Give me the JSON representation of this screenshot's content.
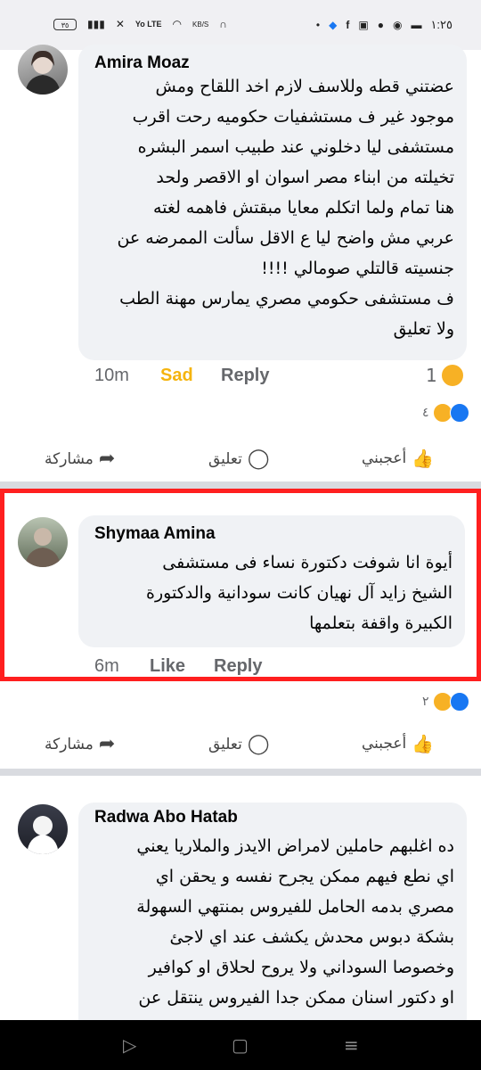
{
  "status_bar": {
    "battery": "٣٥",
    "net_speed": "KB/S",
    "network": "Yo LTE",
    "time": "١:٢٥"
  },
  "comments": [
    {
      "author": "Amira Moaz",
      "lines": [
        "عضتني قطه وللاسف لازم اخد اللقاح ومش",
        "موجود غير ف مستشفيات حكوميه رحت اقرب",
        "مستشفى ليا دخلوني عند طبيب اسمر البشره",
        "تخيلته من ابناء مصر اسوان او الاقصر ولحد",
        "هنا تمام ولما اتكلم معايا مبقتش فاهمه لغته",
        "عربي مش واضح ليا ع الاقل سألت الممرضه عن",
        "جنسيته قالتلي صومالي !!!!",
        "ف مستشفى حكومي مصري يمارس مهنة الطب",
        "ولا تعليق"
      ],
      "time": "10m",
      "reaction_label": "Sad",
      "reply": "Reply",
      "own_reaction_count": "1",
      "post_reactions_count": "٤"
    },
    {
      "author": "Shymaa Amina",
      "lines": [
        "أيوة انا شوفت دكتورة نساء فى مستشفى",
        "الشيخ زايد آل نهيان كانت سودانية والدكتورة",
        "الكبيرة واقفة بتعلمها"
      ],
      "time": "6m",
      "like": "Like",
      "reply": "Reply",
      "post_reactions_count": "٢"
    },
    {
      "author": "Radwa Abo Hatab",
      "lines": [
        "ده اغلبهم حاملين لامراض الايدز والملاريا يعني",
        "اي نطع فيهم ممكن يجرح نفسه و يحقن اي",
        "مصري بدمه الحامل للفيروس بمنتهي السهولة",
        "بشكة دبوس محدش يكشف عند اي لاجئ",
        "وخصوصا السوداني ولا يروح لحلاق او كوافير",
        "او دكتور اسنان ممكن جدا الفيروس ينتقل عن"
      ]
    }
  ],
  "actions": {
    "like": "أعجبني",
    "comment": "تعليق",
    "share": "مشاركة"
  },
  "colors": {
    "facebook_blue": "#1877f2",
    "highlight_red": "#ff1f1f",
    "sad_yellow": "#f5b40e",
    "bubble": "#f0f2f5"
  }
}
